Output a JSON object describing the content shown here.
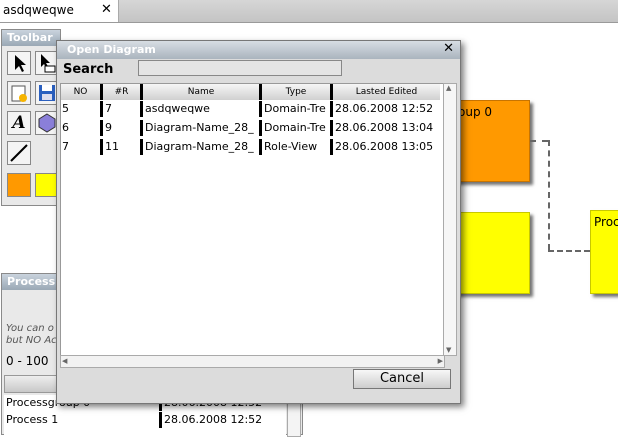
{
  "tab": {
    "title": "asdqweqwe",
    "close": "✕"
  },
  "canvas": {
    "boxes": [
      {
        "label": "oup 0",
        "color": "#ff9900"
      },
      {
        "label": "",
        "color": "#ffff00"
      },
      {
        "label": "Proc",
        "color": "#ffff00"
      }
    ]
  },
  "toolbar": {
    "title": "Toolbar",
    "text_tool": "A"
  },
  "process_panel": {
    "title": "Process",
    "hint_line1": "You can o",
    "hint_line2": "but NO Ac",
    "range": "0 - 100 ",
    "rows": [
      {
        "name": "Processgroup 0",
        "date": "28.06.2008 12:52"
      },
      {
        "name": "Process 1",
        "date": "28.06.2008 12:52"
      }
    ]
  },
  "dialog": {
    "title": "Open Diagram",
    "close": "✕",
    "search_label": "Search",
    "search_value": "",
    "columns": [
      "NO",
      "#R",
      "Name",
      "Type",
      "Lasted Edited"
    ],
    "rows": [
      {
        "no": "5",
        "r": "7",
        "name": "asdqweqwe",
        "type": "Domain-Tre",
        "edited": "28.06.2008 12:52"
      },
      {
        "no": "6",
        "r": "9",
        "name": "Diagram-Name_28_",
        "type": "Domain-Tre",
        "edited": "28.06.2008 13:04"
      },
      {
        "no": "7",
        "r": "11",
        "name": "Diagram-Name_28_",
        "type": "Role-View",
        "edited": "28.06.2008 13:05"
      }
    ],
    "cancel_label": "Cancel"
  }
}
